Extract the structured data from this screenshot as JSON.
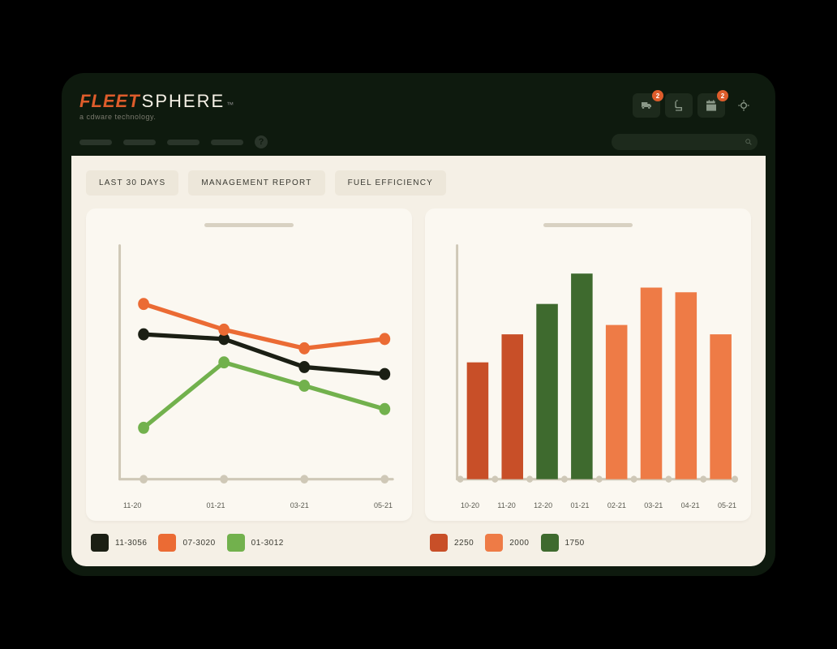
{
  "brand": {
    "fleet": "FLEET",
    "sphere": "SPHERE",
    "tm": "™",
    "subtitle": "a cdware technology."
  },
  "topbar": {
    "badge1": "2",
    "badge2": "2"
  },
  "filters": {
    "f0": "LAST 30 DAYS",
    "f1": "MANAGEMENT REPORT",
    "f2": "FUEL EFFICIENCY"
  },
  "line_chart": {
    "x": {
      "0": "11-20",
      "1": "01-21",
      "2": "03-21",
      "3": "05-21"
    },
    "legend": {
      "0": "11-3056",
      "1": "07-3020",
      "2": "01-3012"
    }
  },
  "bar_chart": {
    "x": {
      "0": "10-20",
      "1": "11-20",
      "2": "12-20",
      "3": "01-21",
      "4": "02-21",
      "5": "03-21",
      "6": "04-21",
      "7": "05-21"
    },
    "legend": {
      "0": "2250",
      "1": "2000",
      "2": "1750"
    }
  },
  "colors": {
    "black": "#1b1f14",
    "orange": "#eb6b34",
    "green": "#72b14d",
    "darkgreen": "#3e6a2e",
    "rust": "#c84f28",
    "lightorange": "#ee7b46",
    "axis": "#cfc8b7"
  },
  "chart_data": [
    {
      "type": "line",
      "title": "",
      "xlabel": "",
      "ylabel": "",
      "categories": [
        "11-20",
        "01-21",
        "03-21",
        "05-21"
      ],
      "ylim": [
        0,
        100
      ],
      "series": [
        {
          "name": "11-3056",
          "color": "#1b1f14",
          "values": [
            62,
            60,
            48,
            45
          ]
        },
        {
          "name": "07-3020",
          "color": "#eb6b34",
          "values": [
            75,
            64,
            56,
            60
          ]
        },
        {
          "name": "01-3012",
          "color": "#72b14d",
          "values": [
            22,
            50,
            40,
            30
          ]
        }
      ]
    },
    {
      "type": "bar",
      "title": "",
      "xlabel": "",
      "ylabel": "",
      "categories": [
        "10-20",
        "11-20",
        "12-20",
        "01-21",
        "02-21",
        "03-21",
        "04-21",
        "05-21"
      ],
      "ylim": [
        0,
        100
      ],
      "series": [
        {
          "name": "2250",
          "color": "#c84f28"
        },
        {
          "name": "2000",
          "color": "#ee7b46"
        },
        {
          "name": "1750",
          "color": "#3e6a2e"
        }
      ],
      "values": [
        50,
        62,
        75,
        88,
        66,
        82,
        80,
        62
      ],
      "bar_series_index": [
        0,
        0,
        2,
        2,
        1,
        1,
        1,
        1
      ]
    }
  ]
}
